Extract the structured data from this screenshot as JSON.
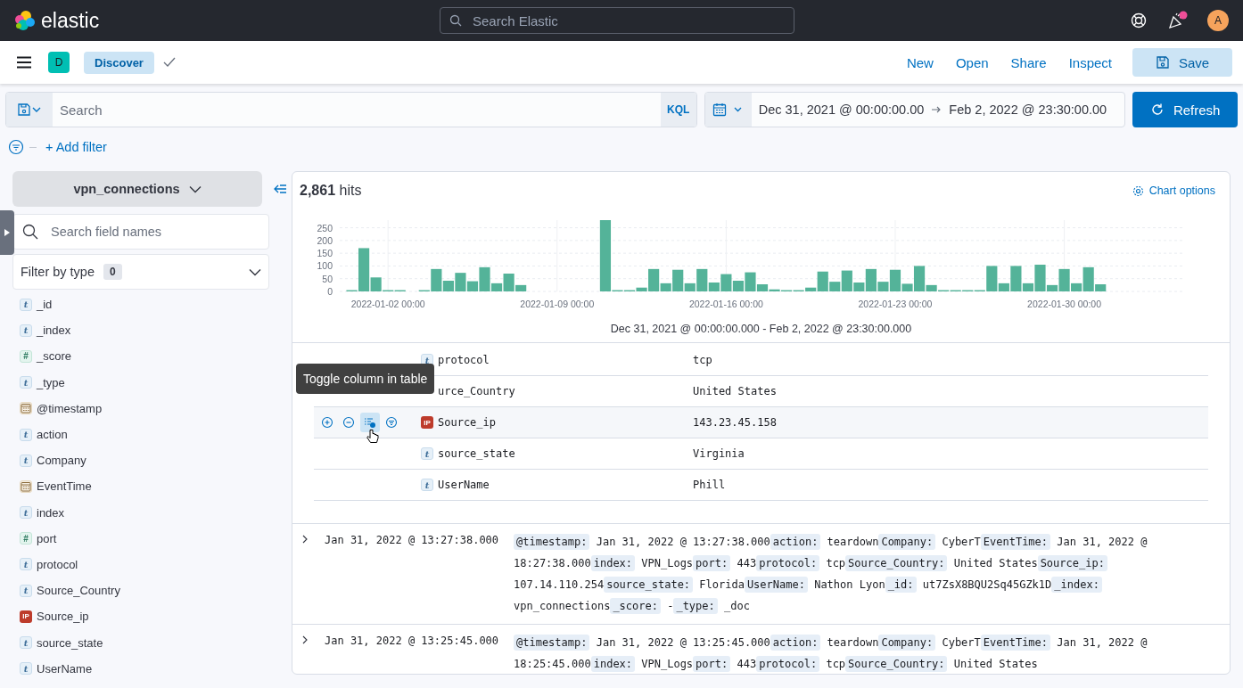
{
  "header": {
    "logo_text": "elastic",
    "search": {
      "placeholder": "Search Elastic"
    },
    "news_unread": true,
    "avatar": "A"
  },
  "app_bar": {
    "space": "D",
    "breadcrumb": "Discover",
    "links": [
      "New",
      "Open",
      "Share",
      "Inspect"
    ],
    "save_label": "Save"
  },
  "query_bar": {
    "placeholder": "Search",
    "language": "KQL",
    "start": "Dec 31, 2021 @ 00:00:00.00",
    "end": "Feb 2, 2022 @ 23:30:00.00",
    "refresh_label": "Refresh"
  },
  "filter_bar": {
    "add_filter": "+ Add filter"
  },
  "sidebar": {
    "index_pattern": "vpn_connections",
    "search": {
      "placeholder": "Search field names"
    },
    "filter_by_type": {
      "label": "Filter by type",
      "count": "0"
    },
    "fields": [
      {
        "name": "_id",
        "kind": "string",
        "glyph": "t"
      },
      {
        "name": "_index",
        "kind": "string",
        "glyph": "t"
      },
      {
        "name": "_score",
        "kind": "number",
        "glyph": "#"
      },
      {
        "name": "_type",
        "kind": "string",
        "glyph": "t"
      },
      {
        "name": "@timestamp",
        "kind": "date"
      },
      {
        "name": "action",
        "kind": "string",
        "glyph": "t"
      },
      {
        "name": "Company",
        "kind": "string",
        "glyph": "t"
      },
      {
        "name": "EventTime",
        "kind": "date"
      },
      {
        "name": "index",
        "kind": "string",
        "glyph": "t"
      },
      {
        "name": "port",
        "kind": "number",
        "glyph": "#"
      },
      {
        "name": "protocol",
        "kind": "string",
        "glyph": "t"
      },
      {
        "name": "Source_Country",
        "kind": "string",
        "glyph": "t"
      },
      {
        "name": "Source_ip",
        "kind": "ip",
        "glyph": "IP"
      },
      {
        "name": "source_state",
        "kind": "string",
        "glyph": "t"
      },
      {
        "name": "UserName",
        "kind": "string",
        "glyph": "t"
      }
    ]
  },
  "results": {
    "hits": "2,861",
    "hits_label": "hits",
    "chart_options": "Chart options",
    "chart_data": {
      "type": "bar",
      "grid": true,
      "ylim": [
        0,
        280
      ],
      "yticks": [
        0,
        50,
        100,
        150,
        200,
        250
      ],
      "categories": [
        null,
        null,
        null,
        "2022-01-02 00:00",
        null,
        null,
        null,
        null,
        null,
        null,
        null,
        null,
        null,
        null,
        null,
        null,
        null,
        "2022-01-09 00:00",
        null,
        null,
        null,
        null,
        null,
        null,
        null,
        null,
        null,
        null,
        null,
        null,
        null,
        "2022-01-16 00:00",
        null,
        null,
        null,
        null,
        null,
        null,
        null,
        null,
        null,
        null,
        null,
        null,
        null,
        "2022-01-23 00:00",
        null,
        null,
        null,
        null,
        null,
        null,
        null,
        null,
        null,
        null,
        null,
        null,
        null,
        "2022-01-30 00:00",
        null,
        null,
        null
      ],
      "series": [
        {
          "color": "#54b399",
          "values": [
            5,
            170,
            55,
            5,
            5,
            0,
            5,
            88,
            42,
            73,
            40,
            95,
            32,
            70,
            25,
            0,
            0,
            0,
            0,
            0,
            0,
            280,
            5,
            5,
            15,
            88,
            32,
            85,
            32,
            88,
            35,
            68,
            42,
            75,
            28,
            8,
            5,
            5,
            15,
            78,
            38,
            82,
            35,
            88,
            38,
            85,
            30,
            100,
            25,
            5,
            5,
            5,
            5,
            100,
            32,
            100,
            32,
            105,
            25,
            88,
            32,
            95,
            28
          ]
        }
      ]
    },
    "time_range": "Dec 31, 2021 @ 00:00:00.000 - Feb 2, 2022 @ 23:30:00.000",
    "detail_fields": [
      {
        "name": "protocol",
        "kind": "string",
        "glyph": "t",
        "value": "tcp",
        "hovered": false
      },
      {
        "name": "urce_Country",
        "value": "United States",
        "hovered": false
      },
      {
        "name": "Source_ip",
        "kind": "ip",
        "glyph": "IP",
        "value": "143.23.45.158",
        "hovered": true
      },
      {
        "name": "source_state",
        "kind": "string",
        "glyph": "t",
        "value": "Virginia",
        "hovered": false
      },
      {
        "name": "UserName",
        "kind": "string",
        "glyph": "t",
        "value": "Phill",
        "hovered": false
      }
    ],
    "tooltip": "Toggle column in table",
    "documents": [
      {
        "timestamp": "Jan 31, 2022 @ 13:27:38.000",
        "fields": [
          {
            "key": "@timestamp:",
            "value": "Jan 31, 2022 @ 13:27:38.000"
          },
          {
            "key": "action:",
            "value": "teardown"
          },
          {
            "key": "Company:",
            "value": "CyberT"
          },
          {
            "key": "EventTime:",
            "value": "Jan 31, 2022 @ 18:27:38.000"
          },
          {
            "key": "index:",
            "value": "VPN_Logs"
          },
          {
            "key": "port:",
            "value": "443"
          },
          {
            "key": "protocol:",
            "value": "tcp"
          },
          {
            "key": "Source_Country:",
            "value": "United States"
          },
          {
            "key": "Source_ip:",
            "value": "107.14.110.254"
          },
          {
            "key": "source_state:",
            "value": "Florida"
          },
          {
            "key": "UserName:",
            "value": "Nathon Lyon"
          },
          {
            "key": "_id:",
            "value": "ut7ZsX8BQU2Sq45GZk1D"
          },
          {
            "key": "_index:",
            "value": "vpn_connections"
          },
          {
            "key": "_score:",
            "value": "-"
          },
          {
            "key": "_type:",
            "value": "_doc"
          }
        ]
      },
      {
        "timestamp": "Jan 31, 2022 @ 13:25:45.000",
        "fields": [
          {
            "key": "@timestamp:",
            "value": "Jan 31, 2022 @ 13:25:45.000"
          },
          {
            "key": "action:",
            "value": "teardown"
          },
          {
            "key": "Company:",
            "value": "CyberT"
          },
          {
            "key": "EventTime:",
            "value": "Jan 31, 2022 @ 18:25:45.000"
          },
          {
            "key": "index:",
            "value": "VPN_Logs"
          },
          {
            "key": "port:",
            "value": "443"
          },
          {
            "key": "protocol:",
            "value": "tcp"
          },
          {
            "key": "Source_Country:",
            "value": "United States"
          }
        ]
      }
    ]
  }
}
